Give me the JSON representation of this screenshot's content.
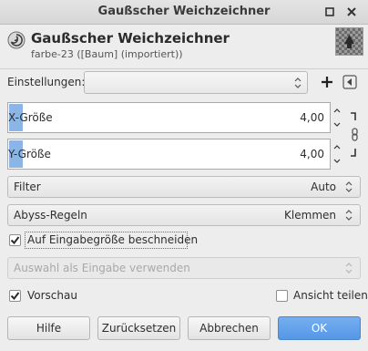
{
  "window": {
    "title": "Gaußscher Weichzeichner"
  },
  "header": {
    "title": "Gaußscher Weichzeichner",
    "subtitle": "farbe-23 ([Baum] (importiert))"
  },
  "settings": {
    "label": "Einstellungen:",
    "value": ""
  },
  "size_x": {
    "label": "X-Größe",
    "value": "4,00"
  },
  "size_y": {
    "label": "Y-Größe",
    "value": "4,00"
  },
  "filter": {
    "label": "Filter",
    "value": "Auto"
  },
  "abyss": {
    "label": "Abyss-Regeln",
    "value": "Klemmen"
  },
  "clip": {
    "label": "Auf Eingabegröße beschneiden",
    "checked": true
  },
  "selection_input": {
    "label": "Auswahl als Eingabe verwenden",
    "enabled": false
  },
  "preview": {
    "label": "Vorschau",
    "checked": true
  },
  "split_view": {
    "label": "Ansicht teilen",
    "checked": false
  },
  "buttons": {
    "help": "Hilfe",
    "reset": "Zurücksetzen",
    "cancel": "Abbrechen",
    "ok": "OK"
  },
  "icons": {
    "titlebar": [
      "restore-icon",
      "close-icon"
    ],
    "header": "gegl-swirl-icon",
    "settings": [
      "add-icon",
      "menu-arrow-icon"
    ],
    "chain": "chain-link-icon"
  },
  "colors": {
    "accent": "#5597e6",
    "bar": "#8ab5e6"
  }
}
